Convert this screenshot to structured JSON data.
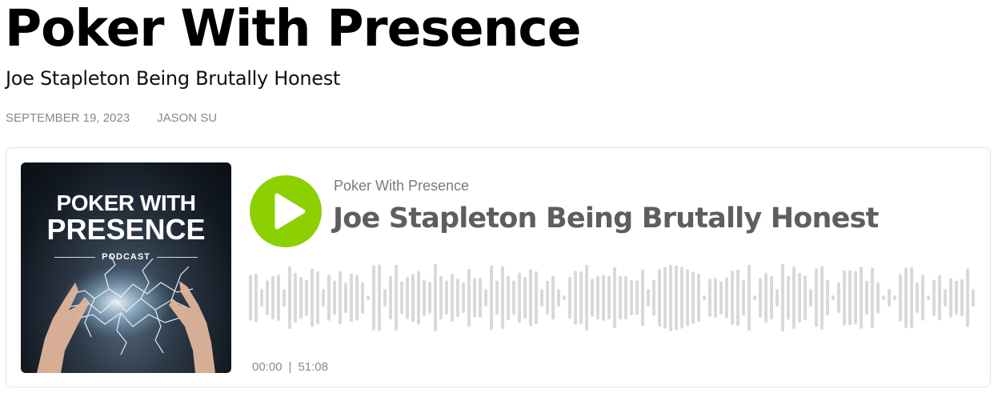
{
  "article": {
    "title": "Poker With Presence",
    "subtitle": "Joe Stapleton Being Brutally Honest",
    "date": "SEPTEMBER 19, 2023",
    "author": "JASON SU"
  },
  "player": {
    "cover": {
      "title_line1": "POKER WITH",
      "title_line2": "PRESENCE",
      "tag": "PODCAST"
    },
    "play_icon": "play-icon",
    "accent_color": "#8cd000",
    "show_name": "Poker With Presence",
    "episode_title": "Joe Stapleton Being Brutally Honest",
    "current_time": "00:00",
    "separator": "|",
    "duration": "51:08",
    "progress": 0
  }
}
